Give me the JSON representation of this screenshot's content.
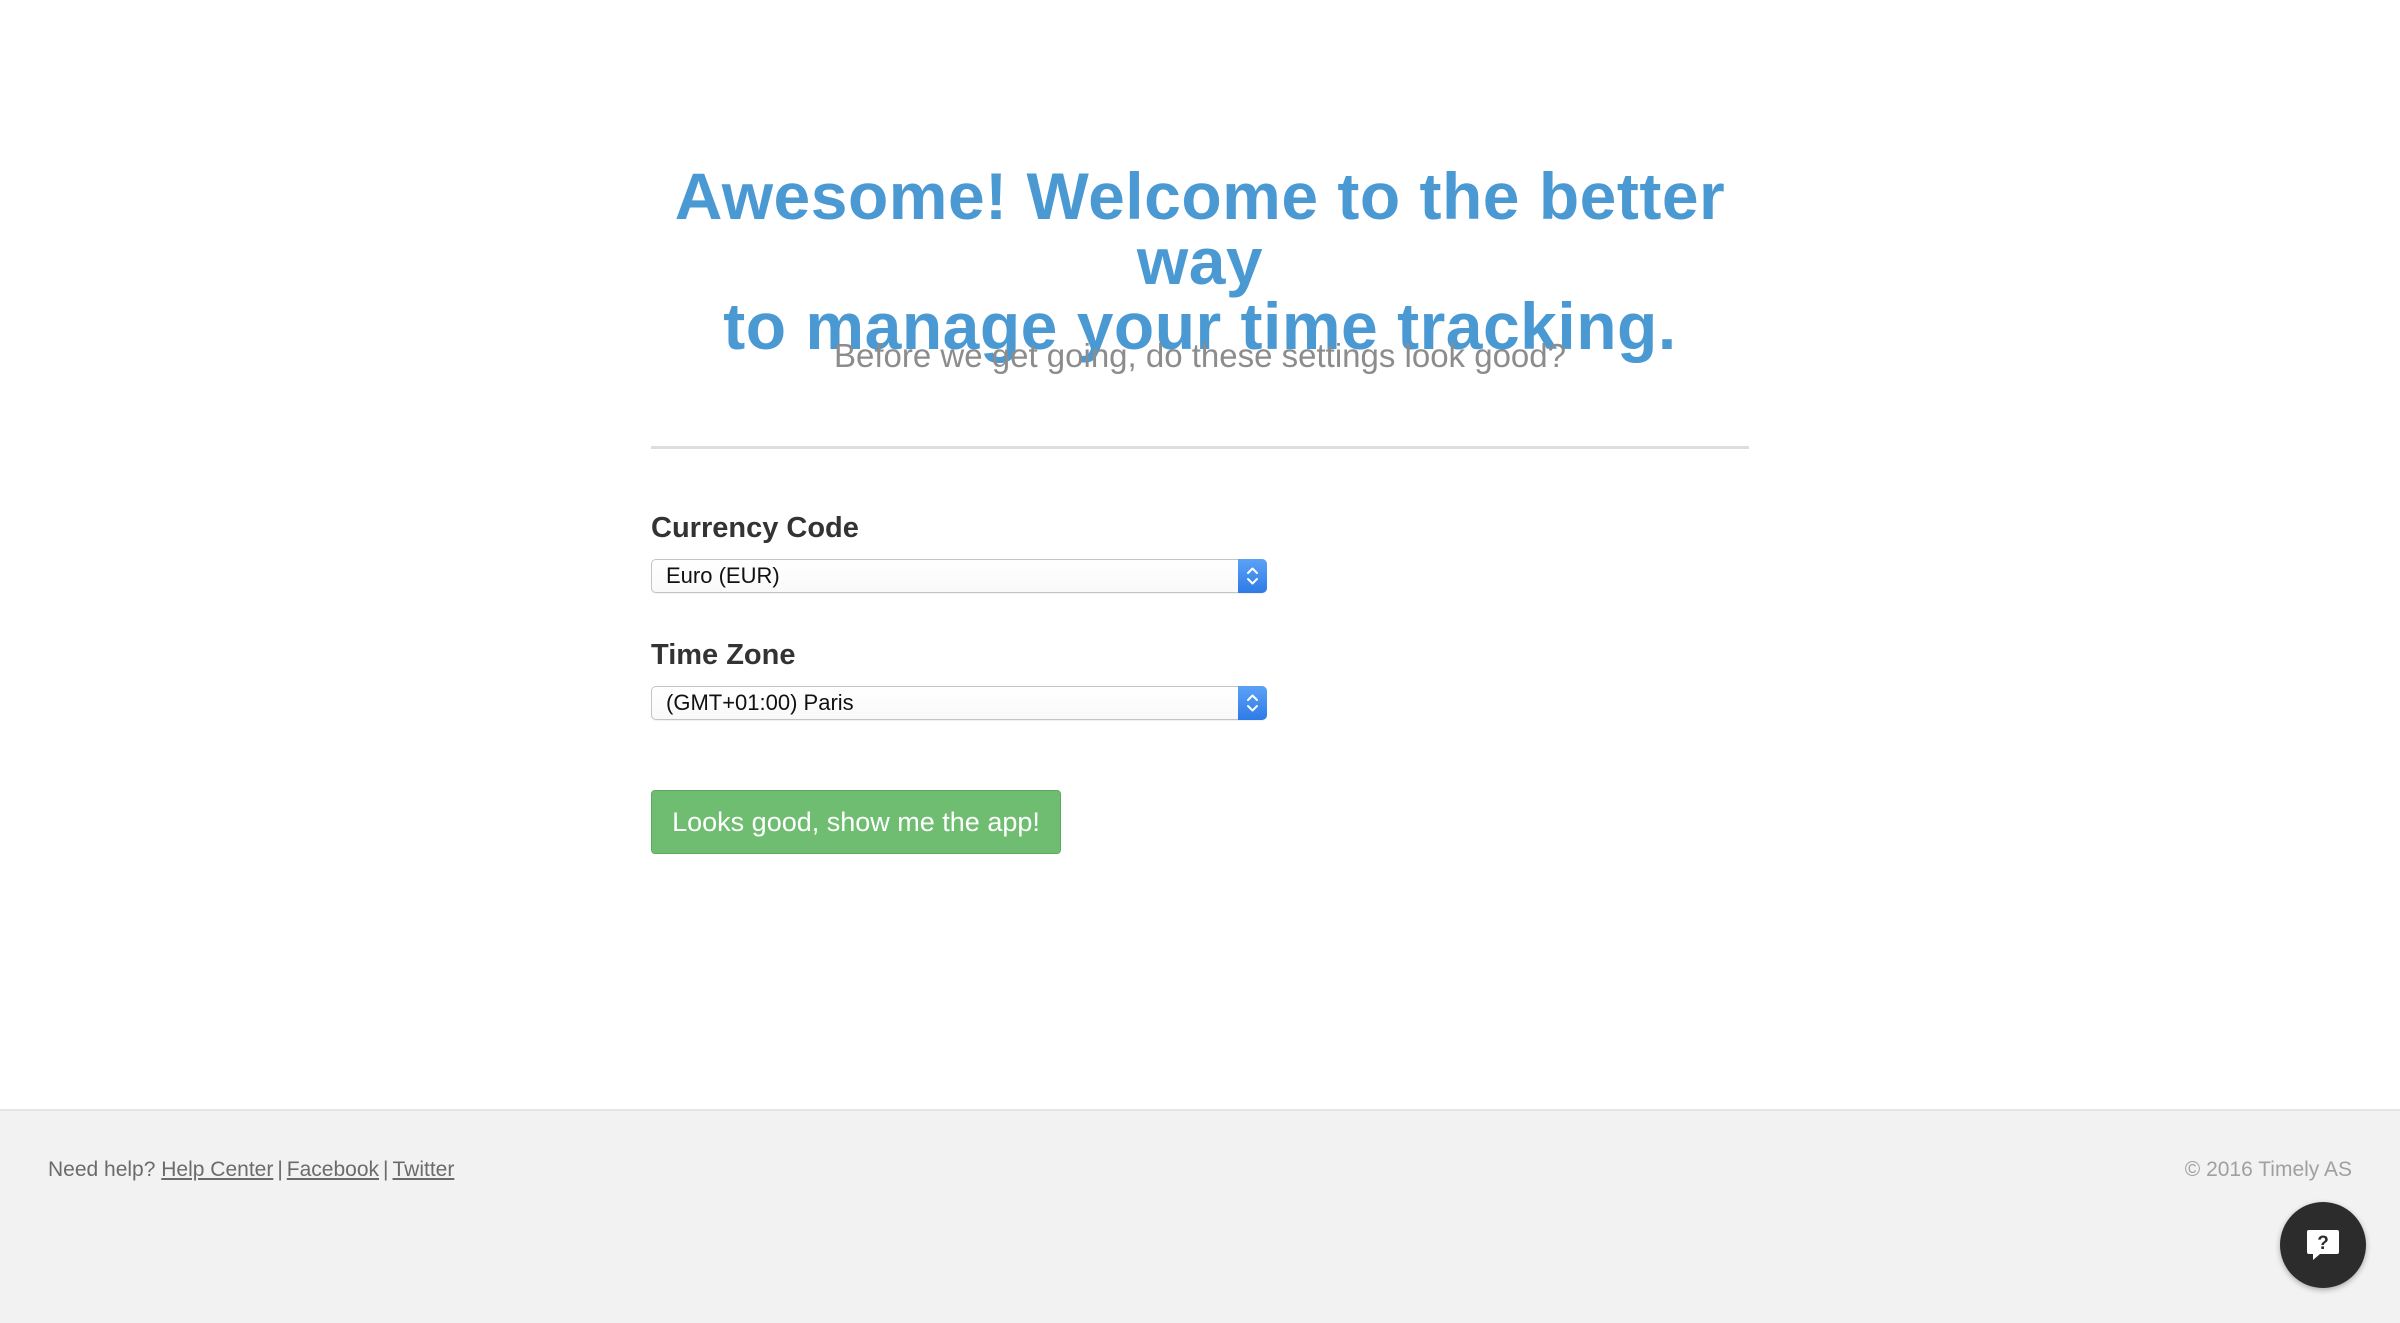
{
  "onboarding": {
    "headline_line1": "Awesome! Welcome to the better way",
    "headline_line2": "to manage your time tracking.",
    "subheading": "Before we get going, do these settings look good?"
  },
  "currency": {
    "label": "Currency Code",
    "selected": "Euro (EUR)"
  },
  "timezone": {
    "label": "Time Zone",
    "selected": "(GMT+01:00) Paris"
  },
  "cta": {
    "label": "Looks good, show me the app!",
    "color": "#6fbd71"
  },
  "footer": {
    "need_help": "Need help?",
    "links": [
      "Help Center",
      "Facebook",
      "Twitter"
    ],
    "separator": "|",
    "copyright": "© 2016 Timely AS"
  },
  "help_widget": {
    "icon": "question-chat-icon",
    "glyph": "?"
  },
  "colors": {
    "headline": "#4a99d3",
    "select_arrow": "#3d89ee",
    "footer_bg": "#f2f2f2"
  }
}
